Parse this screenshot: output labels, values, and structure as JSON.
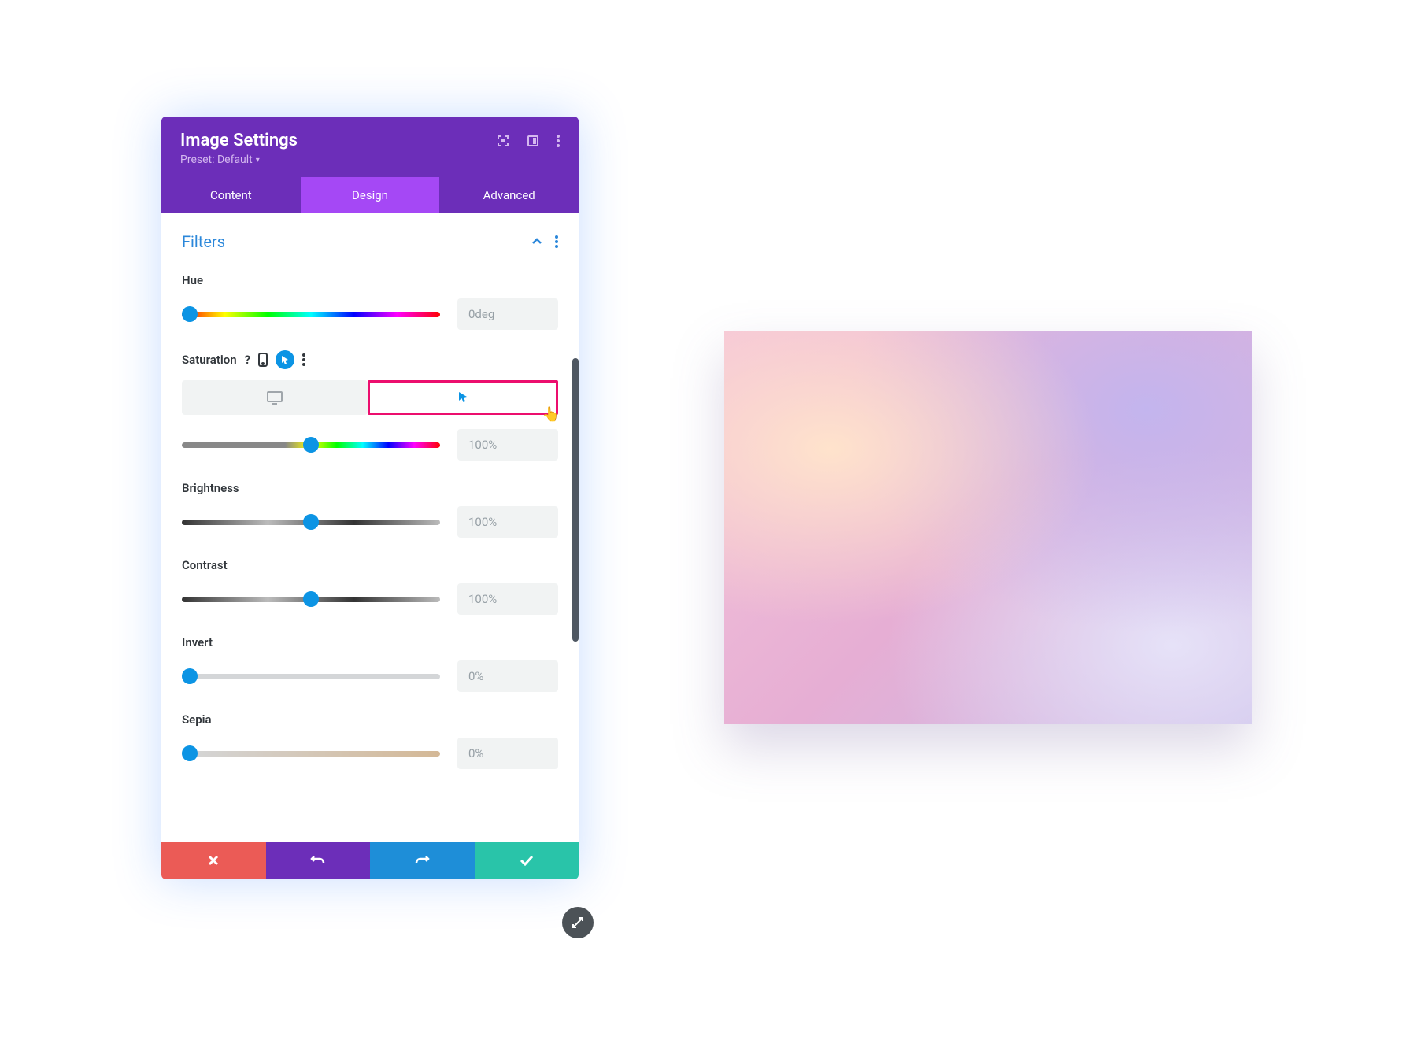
{
  "header": {
    "title": "Image Settings",
    "preset": "Preset: Default"
  },
  "tabs": {
    "content": "Content",
    "design": "Design",
    "advanced": "Advanced"
  },
  "section": {
    "title": "Filters"
  },
  "filters": {
    "hue": {
      "label": "Hue",
      "value": "0deg",
      "thumb": 0
    },
    "saturation": {
      "label": "Saturation",
      "value": "100%",
      "thumb": 50
    },
    "brightness": {
      "label": "Brightness",
      "value": "100%",
      "thumb": 50
    },
    "contrast": {
      "label": "Contrast",
      "value": "100%",
      "thumb": 50
    },
    "invert": {
      "label": "Invert",
      "value": "0%",
      "thumb": 0
    },
    "sepia": {
      "label": "Sepia",
      "value": "0%",
      "thumb": 0
    }
  }
}
